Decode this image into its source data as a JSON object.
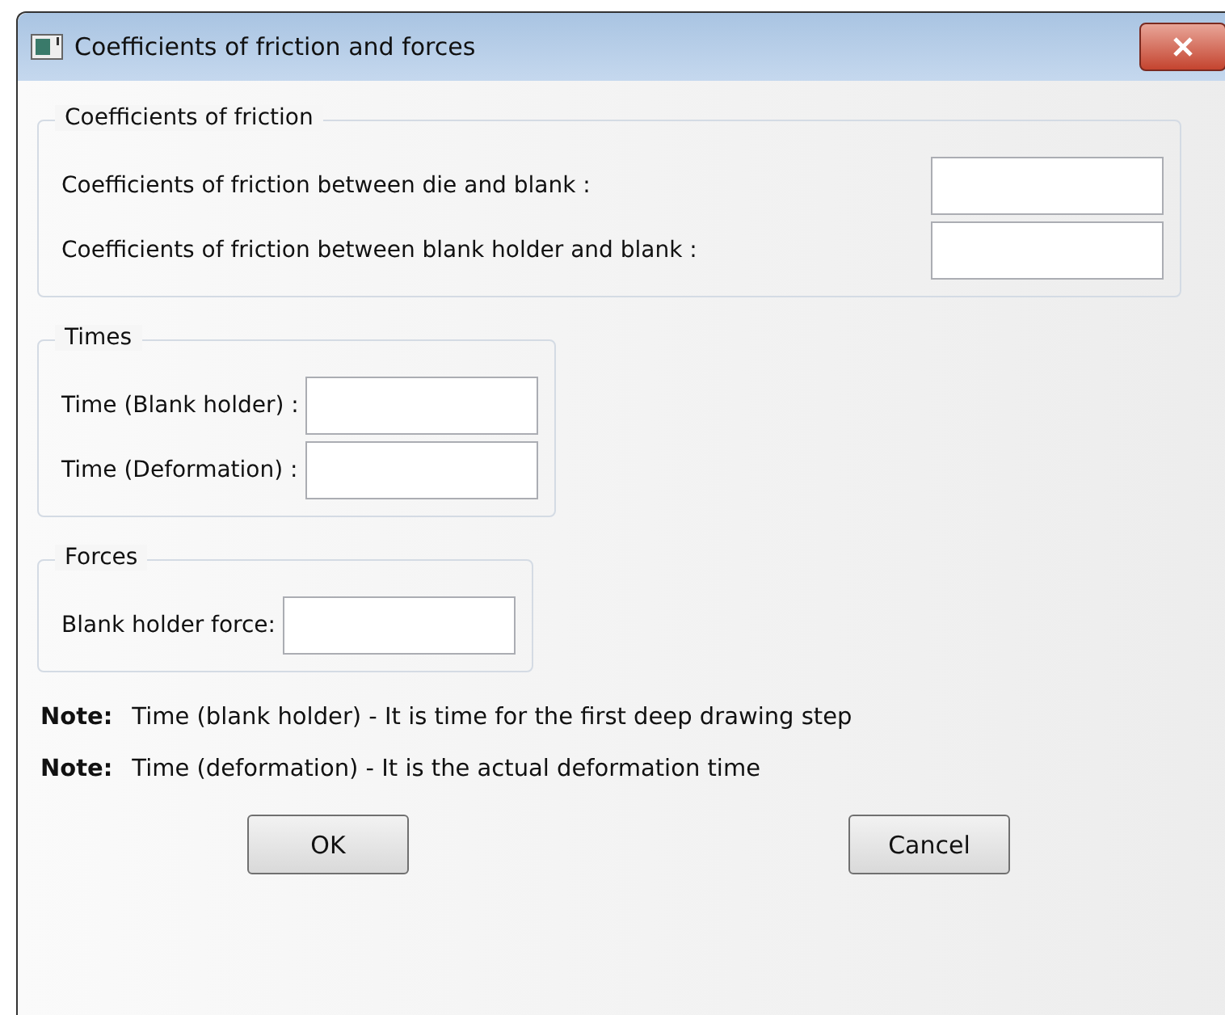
{
  "window": {
    "title": "Coefficients of friction and forces"
  },
  "groups": [
    {
      "title": "Coefficients of friction",
      "wide": true,
      "fields": [
        {
          "label": "Coefficients of friction between die and blank :"
        },
        {
          "label": "Coefficients of friction between blank holder and blank :"
        }
      ]
    },
    {
      "title": "Times",
      "wide": false,
      "fields": [
        {
          "label": "Time (Blank holder) :"
        },
        {
          "label": "Time (Deformation) :"
        }
      ]
    },
    {
      "title": "Forces",
      "wide": false,
      "fields": [
        {
          "label": "Blank holder force:"
        }
      ]
    }
  ],
  "notes": [
    {
      "label": "Note:",
      "text": "Time (blank holder) - It is time for the first deep drawing step"
    },
    {
      "label": "Note:",
      "text": "Time (deformation) - It is the actual deformation time"
    }
  ],
  "buttons": [
    "OK",
    "Cancel"
  ]
}
